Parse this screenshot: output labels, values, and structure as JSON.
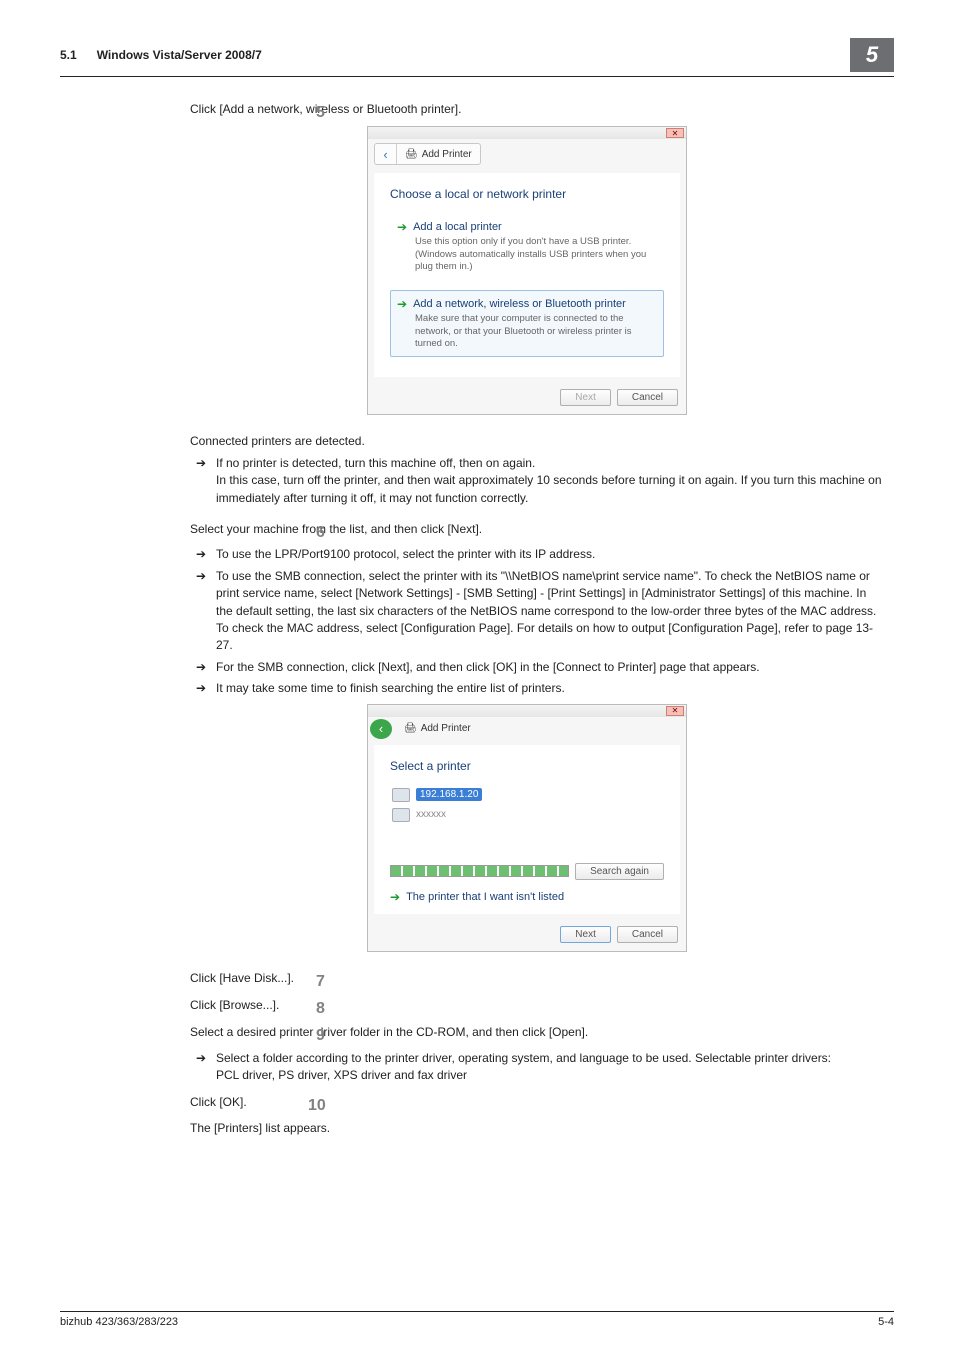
{
  "header": {
    "section": "5.1",
    "title": "Windows Vista/Server 2008/7",
    "chapnum": "5"
  },
  "step5": {
    "num": "5",
    "text": "Click [Add a network, wireless or Bluetooth printer]."
  },
  "dialog1": {
    "crumb_label": "Add Printer",
    "title": "Choose a local or network printer",
    "opt1_h": "Add a local printer",
    "opt1_sub": "Use this option only if you don't have a USB printer. (Windows automatically installs USB printers when you plug them in.)",
    "opt2_h": "Add a network, wireless or Bluetooth printer",
    "opt2_sub": "Make sure that your computer is connected to the network, or that your Bluetooth or wireless printer is turned on.",
    "btn_next": "Next",
    "btn_cancel": "Cancel"
  },
  "after5": {
    "p1": "Connected printers are detected.",
    "b1a": "If no printer is detected, turn this machine off, then on again.",
    "b1b": "In this case, turn off the printer, and then wait approximately 10 seconds before turning it on again. If you turn this machine on immediately after turning it off, it may not function correctly."
  },
  "step6": {
    "num": "6",
    "text": "Select your machine from the list, and then click [Next].",
    "b1": "To use the LPR/Port9100 protocol, select the printer with its IP address.",
    "b2": "To use the SMB connection, select the printer with its \"\\\\NetBIOS name\\print service name\". To check the NetBIOS name or print service name, select [Network Settings] - [SMB Setting] - [Print Settings] in [Administrator Settings] of  this machine. In the default setting, the last six characters of the NetBIOS name correspond to the low-order three bytes of the MAC address.",
    "b2b": "To check the MAC address, select [Configuration Page]. For details on how to output [Configuration Page], refer to page 13-27.",
    "b3": "For the SMB connection, click [Next], and then click [OK] in the [Connect to Printer] page that appears.",
    "b4": "It may take some time to finish searching the entire list of printers."
  },
  "dialog2": {
    "crumb_label": "Add Printer",
    "title": "Select a printer",
    "item1": "192.168.1.20",
    "item2": "xxxxxx",
    "search_again": "Search again",
    "not_listed": "The printer that I want isn't listed",
    "btn_next": "Next",
    "btn_cancel": "Cancel"
  },
  "step7": {
    "num": "7",
    "text": "Click [Have Disk...]."
  },
  "step8": {
    "num": "8",
    "text": "Click [Browse...]."
  },
  "step9": {
    "num": "9",
    "text": "Select a desired printer driver folder in the CD-ROM, and then click [Open].",
    "b1": "Select a folder according to the printer driver, operating system, and language to be used. Selectable printer drivers:",
    "b1b": "PCL driver, PS driver, XPS driver and fax driver"
  },
  "step10": {
    "num": "10",
    "text": "Click [OK].",
    "after": "The [Printers] list appears."
  },
  "footer": {
    "left": "bizhub 423/363/283/223",
    "right": "5-4"
  }
}
